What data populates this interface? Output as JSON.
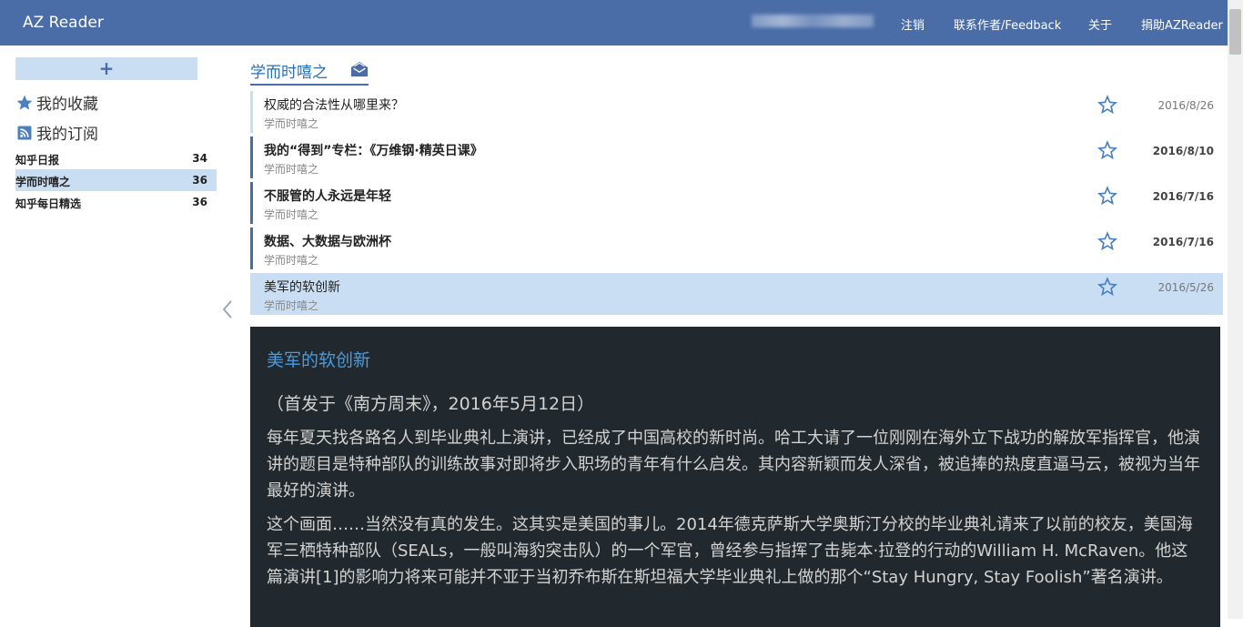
{
  "app": {
    "brand": "AZ Reader"
  },
  "nav": {
    "logout": "注销",
    "contact": "联系作者/Feedback",
    "about": "关于",
    "donate": "捐助AZReader"
  },
  "sidebar": {
    "add_label": "+",
    "favorites": "我的收藏",
    "subscriptions": "我的订阅",
    "feeds": [
      {
        "name": "知乎日报",
        "count": "34"
      },
      {
        "name": "学而时嘻之",
        "count": "36"
      },
      {
        "name": "知乎每日精选",
        "count": "36"
      }
    ]
  },
  "feed": {
    "title": "学而时嘻之",
    "articles": [
      {
        "title": "权威的合法性从哪里来？",
        "source": "学而时嘻之",
        "date": "2016/8/26"
      },
      {
        "title": "我的“得到”专栏：《万维钢·精英日课》",
        "source": "学而时嘻之",
        "date": "2016/8/10"
      },
      {
        "title": "不服管的人永远是年轻",
        "source": "学而时嘻之",
        "date": "2016/7/16"
      },
      {
        "title": "数据、大数据与欧洲杯",
        "source": "学而时嘻之",
        "date": "2016/7/16"
      },
      {
        "title": "美军的软创新",
        "source": "学而时嘻之",
        "date": "2016/5/26"
      }
    ]
  },
  "reader": {
    "title": "美军的软创新",
    "paragraphs": [
      "（首发于《南方周末》，2016年5月12日）",
      "每年夏天找各路名人到毕业典礼上演讲，已经成了中国高校的新时尚。哈工大请了一位刚刚在海外立下战功的解放军指挥官，他演讲的题目是特种部队的训练故事对即将步入职场的青年有什么启发。其内容新颖而发人深省，被追捧的热度直逼马云，被视为当年最好的演讲。",
      "这个画面……当然没有真的发生。这其实是美国的事儿。2014年德克萨斯大学奥斯汀分校的毕业典礼请来了以前的校友，美国海军三栖特种部队（SEALs，一般叫海豹突击队）的一个军官，曾经参与指挥了击毙本·拉登的行动的William H. McRaven。他这篇演讲[1]的影响力将来可能并不亚于当初乔布斯在斯坦福大学毕业典礼上做的那个“Stay Hungry, Stay Foolish”著名演讲。"
    ]
  },
  "colors": {
    "navbar": "#4a6ca7",
    "highlight": "#c9def3",
    "reader_bg": "#22292e",
    "reader_title": "#4b9bdc"
  }
}
